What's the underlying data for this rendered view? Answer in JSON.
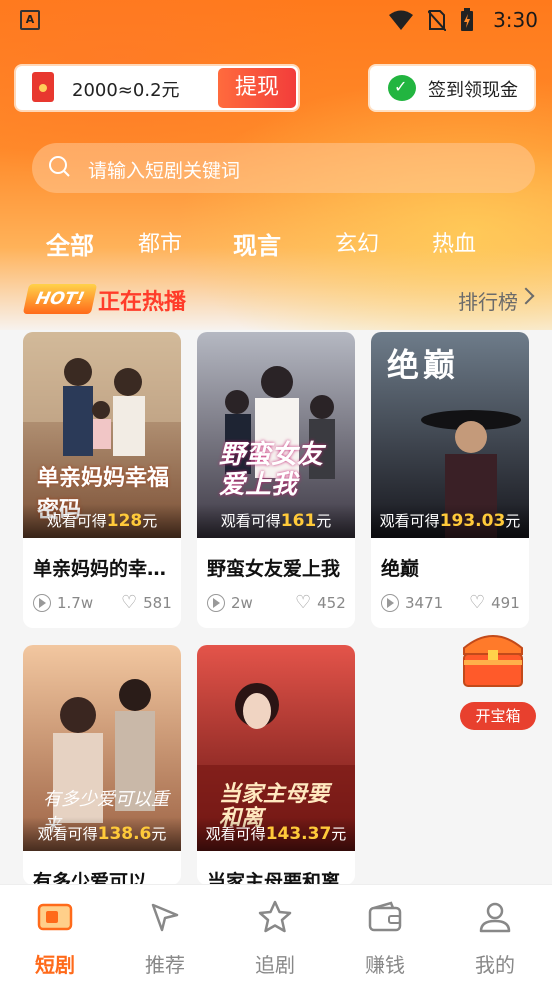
{
  "status": {
    "time": "3:30"
  },
  "top": {
    "coin_text": "2000≈0.2元",
    "withdraw_label": "提现",
    "signin_label": "签到领现金"
  },
  "search": {
    "placeholder": "请输入短剧关键词"
  },
  "categories": [
    {
      "label": "全部",
      "bold": true
    },
    {
      "label": "都市",
      "bold": false
    },
    {
      "label": "现言",
      "bold": true
    },
    {
      "label": "玄幻",
      "bold": false
    },
    {
      "label": "热血",
      "bold": false
    }
  ],
  "section": {
    "badge": "HOT!",
    "title": "正在热播",
    "rank_label": "排行榜"
  },
  "dramas": [
    {
      "title": "单亲妈妈的幸福妈妈",
      "reward_prefix": "观看可得",
      "reward_amount": "128",
      "reward_unit": "元",
      "plays": "1.7w",
      "likes": "581",
      "poster_text": "单亲妈妈幸福密码",
      "colors": [
        "#c9a27a",
        "#6a4a3a"
      ]
    },
    {
      "title": "野蛮女友爱上我",
      "reward_prefix": "观看可得",
      "reward_amount": "161",
      "reward_unit": "元",
      "plays": "2w",
      "likes": "452",
      "poster_text": "野蛮女友爱上我",
      "colors": [
        "#8a8f9c",
        "#3e3a46"
      ]
    },
    {
      "title": "绝巅",
      "reward_prefix": "观看可得",
      "reward_amount": "193.03",
      "reward_unit": "元",
      "plays": "3471",
      "likes": "491",
      "poster_text": "绝巅",
      "colors": [
        "#5a6a7a",
        "#1d1e26"
      ]
    },
    {
      "title": "有多少爱可以重来",
      "reward_prefix": "观看可得",
      "reward_amount": "138.6",
      "reward_unit": "元",
      "plays": "",
      "likes": "",
      "poster_text": "有多少爱可以重来",
      "colors": [
        "#e9b08a",
        "#a86a4a"
      ]
    },
    {
      "title": "当家主母要和离",
      "reward_prefix": "观看可得",
      "reward_amount": "143.37",
      "reward_unit": "元",
      "plays": "",
      "likes": "",
      "poster_text": "当家主母要和离",
      "colors": [
        "#d7463a",
        "#6b1412"
      ]
    }
  ],
  "treasure": {
    "label": "开宝箱"
  },
  "tabs": [
    {
      "label": "短剧",
      "icon": "tv-icon",
      "active": true
    },
    {
      "label": "推荐",
      "icon": "cursor-icon",
      "active": false
    },
    {
      "label": "追剧",
      "icon": "star-icon",
      "active": false
    },
    {
      "label": "赚钱",
      "icon": "wallet-icon",
      "active": false
    },
    {
      "label": "我的",
      "icon": "user-icon",
      "active": false
    }
  ],
  "theme": {
    "accent": "#ff6a1a",
    "hot_red": "#ff3c2a",
    "reward_gold": "#ffca3a"
  }
}
